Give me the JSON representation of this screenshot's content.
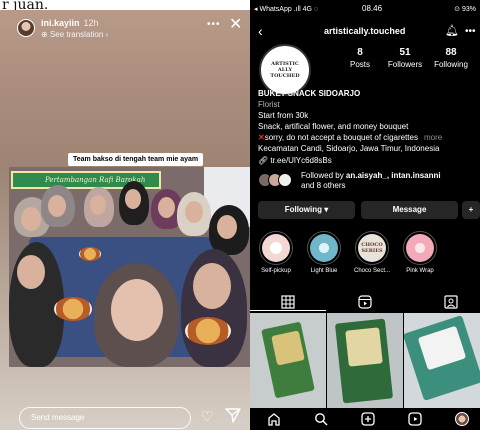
{
  "top_cut_text": "r juan.",
  "story": {
    "username": "ini.kayiin",
    "time": "12h",
    "see_translation": "See translation",
    "more_icon": "more-dots-icon",
    "close_icon": "close-icon",
    "caption": "Team bakso di tengah team mie ayam",
    "banner_text": "Pertambangan Rafi Barokah",
    "send_placeholder": "Send message",
    "heart_icon": "heart-icon",
    "send_icon": "paper-plane-icon"
  },
  "status_bar": {
    "left": "◂ WhatsApp .ıll 4G ◌",
    "time": "08.46",
    "right": "⊙ 93%"
  },
  "profile": {
    "handle": "artistically.touched",
    "pfp_text": "ARTISTIC ALLY TOUCHED",
    "stats": [
      {
        "num": "8",
        "label": "Posts"
      },
      {
        "num": "51",
        "label": "Followers"
      },
      {
        "num": "88",
        "label": "Following"
      }
    ],
    "bio": {
      "name": "BUKET SNACK SIDOARJO",
      "category": "Florist",
      "line1": "Start from 30k",
      "line2": "Snack, artifical flower, and money bouquet",
      "line3": "sorry, do not accept a bouquet of cigarettes",
      "more": "more",
      "line4": "Kecamatan Candi, Sidoarjo, Jawa Timur, Indonesia"
    },
    "link": "tr.ee/UlYc6d8sBs",
    "followed_by_prefix": "Followed by ",
    "followed_by_names": "an.aisyah_, intan.insanni",
    "followed_by_suffix": " and 8 others",
    "buttons": {
      "following": "Following",
      "message": "Message",
      "add_user": "+8"
    },
    "highlights": [
      {
        "label": "Self-pickup",
        "color": "#f3d7d2"
      },
      {
        "label": "Light Blue",
        "color": "#6fb7c9"
      },
      {
        "label": "Choco Sect...",
        "color": "#5b3a2b",
        "inner_text": "CHOCO SERIES"
      },
      {
        "label": "Pink Wrap",
        "color": "#f2a9b8"
      }
    ]
  },
  "colors": {
    "accent": "#0095f6",
    "dark_button": "#262626",
    "warning": "#e0301e"
  }
}
